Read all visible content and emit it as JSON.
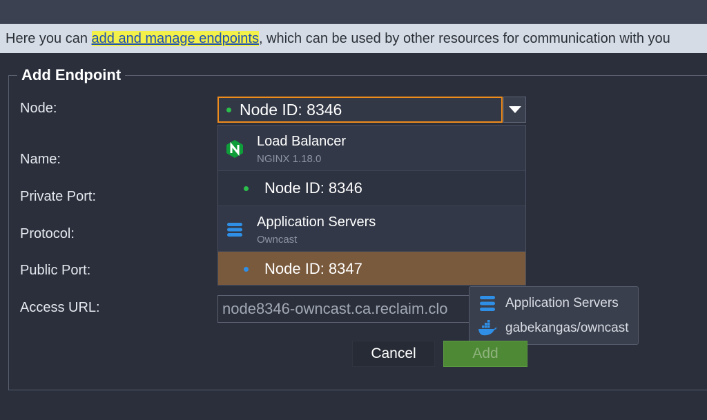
{
  "info": {
    "prefix": "Here you can ",
    "link": "add and manage endpoints",
    "suffix": ", which can be used by other resources for communication with you"
  },
  "form": {
    "legend": "Add Endpoint",
    "labels": {
      "node": "Node:",
      "name": "Name:",
      "private_port": "Private Port:",
      "protocol": "Protocol:",
      "public_port": "Public Port:",
      "access_url": "Access URL:"
    },
    "node_select": {
      "value": "Node ID: 8346",
      "status_color": "#2bbf4b"
    },
    "access_url_value": "node8346-owncast.ca.reclaim.clo"
  },
  "dropdown": {
    "groups": [
      {
        "title": "Load Balancer",
        "subtitle": "NGINX 1.18.0",
        "icon": "nginx-icon",
        "nodes": [
          {
            "label": "Node ID: 8346",
            "dot_color": "#2bbf4b",
            "selected": false
          }
        ]
      },
      {
        "title": "Application Servers",
        "subtitle": "Owncast",
        "icon": "server-stack-icon",
        "nodes": [
          {
            "label": "Node ID: 8347",
            "dot_color": "#2f8fe6",
            "selected": true
          }
        ]
      }
    ]
  },
  "tooltip": {
    "line1": "Application Servers",
    "line1_icon": "server-stack-icon",
    "line2": "gabekangas/owncast",
    "line2_icon": "docker-icon"
  },
  "buttons": {
    "cancel": "Cancel",
    "add": "Add"
  },
  "colors": {
    "accent_border": "#f08c1c",
    "selected_row": "#7a5a3d",
    "add_button": "#4e8a36",
    "link_highlight": "#f3f04a"
  }
}
